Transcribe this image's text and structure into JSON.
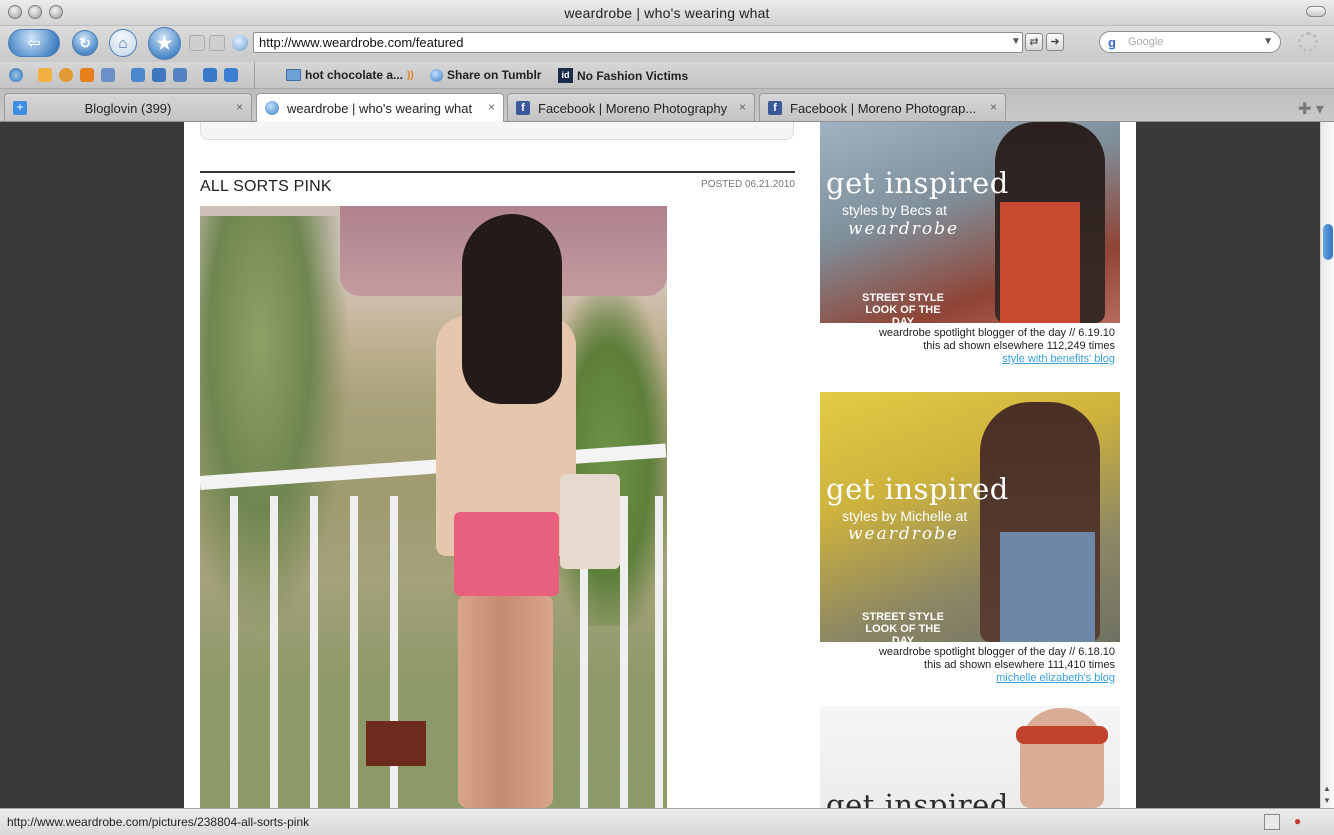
{
  "window": {
    "title": "weardrobe | who's wearing what"
  },
  "navbar": {
    "url": "http://www.weardrobe.com/featured",
    "search_placeholder": "Google",
    "search_engine_icon": "google-g-icon"
  },
  "bookmarks": {
    "items": [
      {
        "label": "hot chocolate a...",
        "icon": "folder-icon"
      },
      {
        "label": "Share on Tumblr",
        "icon": "globe-icon"
      },
      {
        "label": "No Fashion Victims",
        "icon": "id-icon"
      }
    ]
  },
  "tabs": [
    {
      "label": "Bloglovin (399)",
      "icon": "plus-icon",
      "active": false
    },
    {
      "label": "weardrobe | who's wearing what",
      "icon": "globe-icon",
      "active": true
    },
    {
      "label": "Facebook | Moreno Photography",
      "icon": "facebook-icon",
      "active": false
    },
    {
      "label": "Facebook | Moreno Photograp...",
      "icon": "facebook-icon",
      "active": false
    }
  ],
  "post": {
    "title": "ALL SORTS PINK",
    "date": "POSTED 06.21.2010"
  },
  "ads": [
    {
      "headline": "get inspired",
      "sub": "styles by Becs at",
      "brand": "weardrobe",
      "street": "STREET STYLE LOOK OF THE DAY",
      "line1": "weardrobe spotlight blogger of the day // 6.19.10",
      "line2": "this ad shown elsewhere 112,249 times",
      "link": "style with benefits' blog",
      "colors": {
        "top": "#9fb3c4",
        "bottom": "#8f4436"
      }
    },
    {
      "headline": "get inspired",
      "sub": "styles by Michelle at",
      "brand": "weardrobe",
      "street": "STREET STYLE LOOK OF THE DAY",
      "line1": "weardrobe spotlight blogger of the day // 6.18.10",
      "line2": "this ad shown elsewhere 111,410 times",
      "link": "michelle elizabeth's blog",
      "colors": {
        "top": "#d7c23c",
        "bottom": "#7c7a5a"
      }
    },
    {
      "headline": "get inspired"
    }
  ],
  "status": {
    "text": "http://www.weardrobe.com/pictures/238804-all-sorts-pink"
  }
}
